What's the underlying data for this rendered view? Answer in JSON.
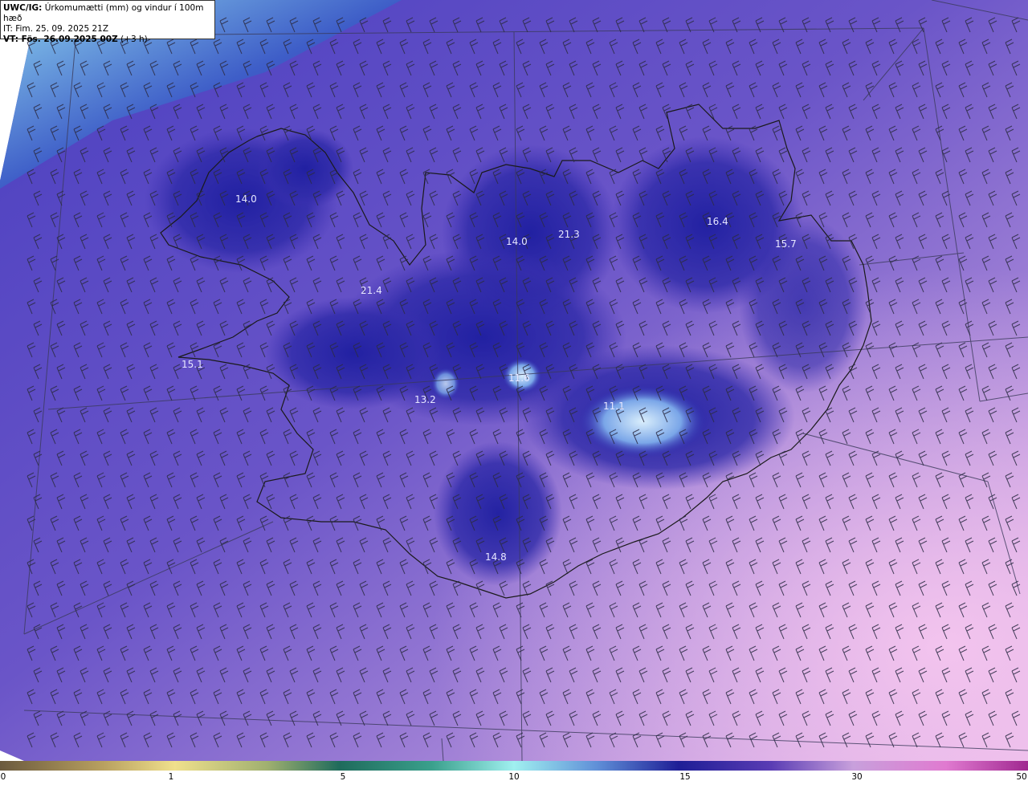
{
  "header": {
    "line1_bold": "UWC/IG:",
    "line1_text": " Úrkomumætti (mm) og vindur í 100m hæð",
    "line2_text": "IT: Fim. 25. 09. 2025 21Z",
    "line3_bold": "VT: Fös. 26.09.2025 00Z",
    "line3_text": " (+3 h)"
  },
  "value_labels": [
    {
      "id": "label-vestfirdir",
      "text": "14.0"
    },
    {
      "id": "label-trollaskagi",
      "text": "14.0"
    },
    {
      "id": "label-eyjafjordur",
      "text": "21.3"
    },
    {
      "id": "label-nordausturland",
      "text": "16.4"
    },
    {
      "id": "label-austfirdir",
      "text": "15.7"
    },
    {
      "id": "label-hunafloi",
      "text": "21.4"
    },
    {
      "id": "label-snaefellsnes",
      "text": "15.1"
    },
    {
      "id": "label-langjokull",
      "text": "13.2"
    },
    {
      "id": "label-hofsjokull",
      "text": "11.6"
    },
    {
      "id": "label-vatnajokull",
      "text": "11.1"
    },
    {
      "id": "label-sudurland",
      "text": "14.8"
    }
  ],
  "colorbar": {
    "ticks": [
      "0",
      "1",
      "5",
      "10",
      "15",
      "30",
      "50"
    ],
    "colors": [
      "#6b5a3e",
      "#c8b46a",
      "#f0e08c",
      "#1f6b5c",
      "#3aa08c",
      "#a0f0f0",
      "#1e1e96",
      "#5a3cb4",
      "#c8a0dc",
      "#a02890"
    ]
  }
}
